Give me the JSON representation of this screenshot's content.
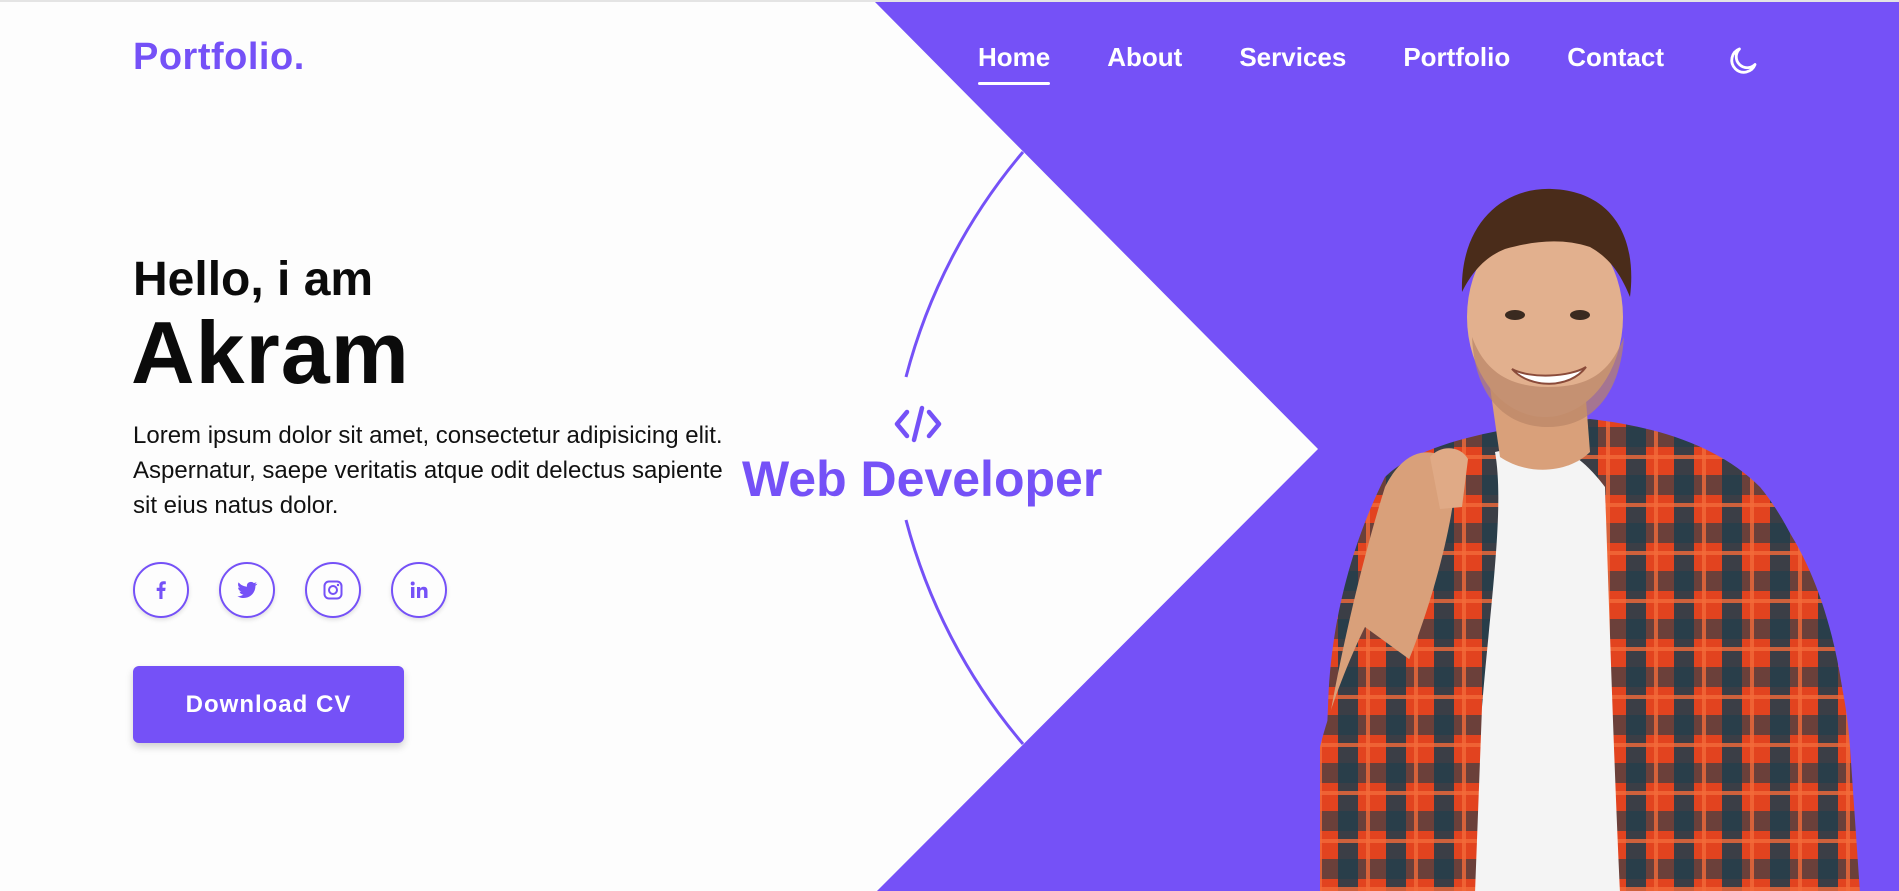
{
  "brand": {
    "logo": "Portfolio."
  },
  "nav": {
    "items": [
      {
        "label": "Home",
        "active": true
      },
      {
        "label": "About"
      },
      {
        "label": "Services"
      },
      {
        "label": "Portfolio"
      },
      {
        "label": "Contact"
      }
    ],
    "theme_toggle_icon": "moon-icon"
  },
  "hero": {
    "greeting": "Hello, i am",
    "name": "Akram",
    "description": "Lorem ipsum dolor sit amet, consectetur adipisicing elit. Aspernatur, saepe veritatis atque odit delectus sapiente sit eius natus dolor.",
    "role": "Web Developer",
    "role_icon": "code-icon",
    "cta_label": "Download CV"
  },
  "socials": [
    {
      "icon": "facebook-icon"
    },
    {
      "icon": "twitter-icon"
    },
    {
      "icon": "instagram-icon"
    },
    {
      "icon": "linkedin-icon"
    }
  ],
  "colors": {
    "accent": "#7551f7",
    "background": "#fdfdfd",
    "text": "#0b0b0b"
  }
}
